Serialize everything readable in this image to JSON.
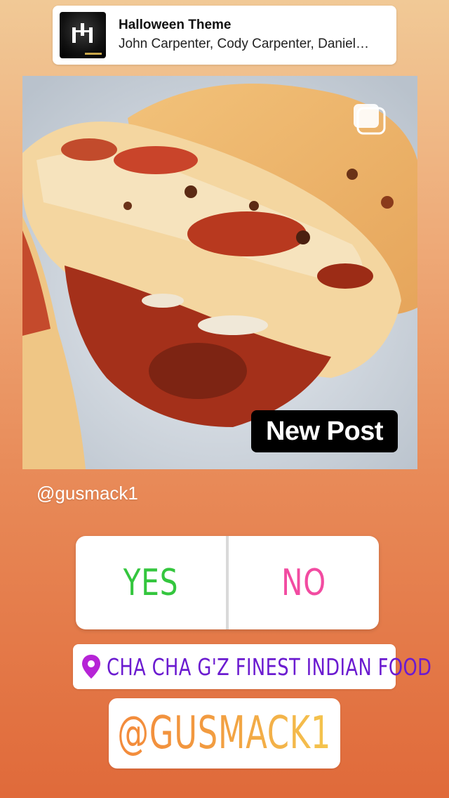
{
  "music": {
    "title": "Halloween Theme",
    "artists": "John Carpenter, Cody Carpenter, Daniel…"
  },
  "post": {
    "badge": "New Post"
  },
  "mention_small": "@gusmack1",
  "poll": {
    "yes_label": "YES",
    "no_label": "NO",
    "yes_color": "#34c63e",
    "no_color": "#f24ba1"
  },
  "location": {
    "label": "CHA CHA G'Z FINEST INDIAN FOOD",
    "color": "#6b1bd0"
  },
  "mention_big": "@GUSMACK1",
  "icons": {
    "music": "album-art",
    "multi": "multiple-posts-icon",
    "location": "location-pin-icon"
  }
}
